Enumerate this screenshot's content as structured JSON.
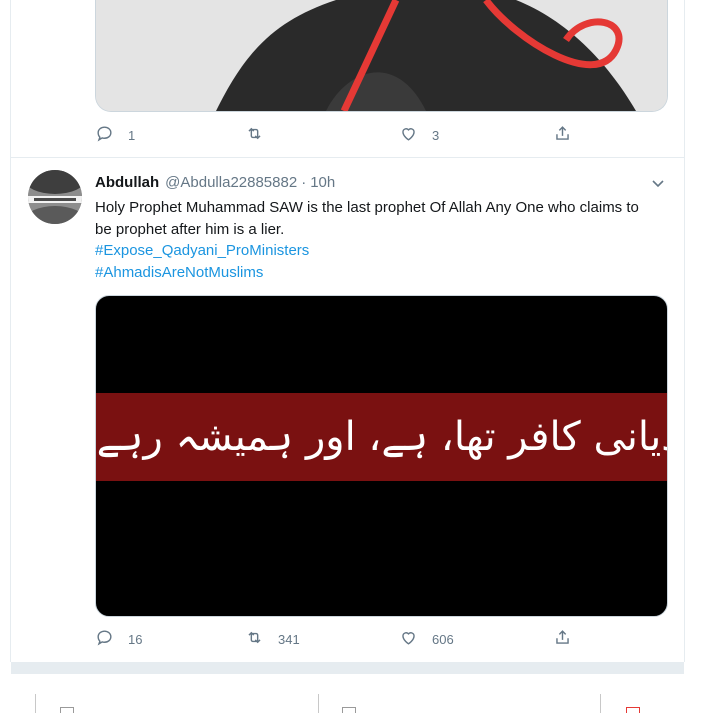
{
  "previous_tweet": {
    "actions": {
      "reply_count": "1",
      "retweet_count": "",
      "like_count": "3"
    }
  },
  "tweet": {
    "author_name": "Abdullah",
    "author_handle": "@Abdulla22885882",
    "separator": "·",
    "timestamp": "10h",
    "text": "Holy Prophet Muhammad SAW is the last prophet Of Allah Any One who claims to be prophet after him is a lier.",
    "hashtags": [
      "#Expose_Qadyani_ProMinisters",
      "#AhmadisAreNotMuslims"
    ],
    "image_text": "قادیانی کافر تھا، ہے، اور ہمیشہ رہے گا",
    "actions": {
      "reply_count": "16",
      "retweet_count": "341",
      "like_count": "606"
    }
  },
  "colors": {
    "link": "#1b95e0",
    "muted": "#657786",
    "border": "#e6ecf0",
    "banner": "#7a1111"
  },
  "icons": [
    "reply-icon",
    "retweet-icon",
    "like-icon",
    "share-icon",
    "chevron-down-icon"
  ]
}
